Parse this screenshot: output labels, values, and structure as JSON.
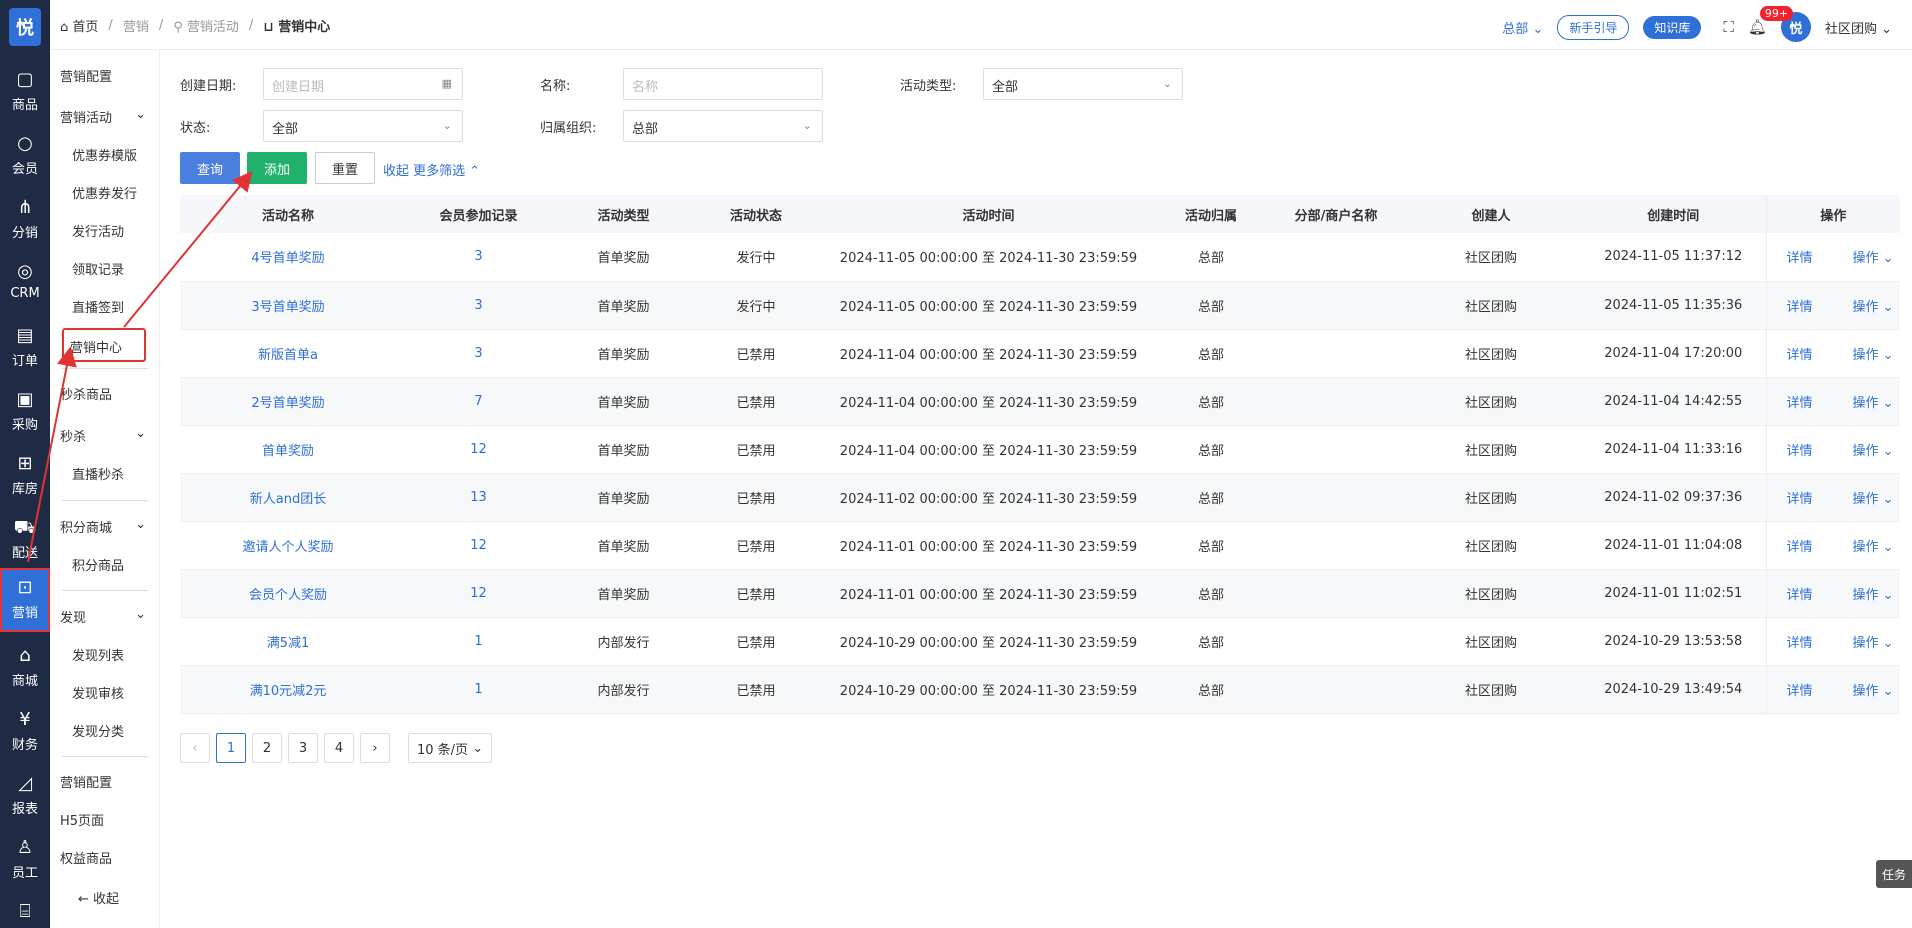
{
  "rail": {
    "logo": "悦",
    "items": [
      {
        "label": "商品",
        "icon": "bag-icon"
      },
      {
        "label": "会员",
        "icon": "person-icon"
      },
      {
        "label": "分销",
        "icon": "network-icon"
      },
      {
        "label": "CRM",
        "icon": "crm-icon"
      },
      {
        "label": "订单",
        "icon": "document-icon"
      },
      {
        "label": "采购",
        "icon": "clipboard-icon"
      },
      {
        "label": "库房",
        "icon": "grid-icon"
      },
      {
        "label": "配送",
        "icon": "truck-icon"
      },
      {
        "label": "营销",
        "icon": "gift-icon"
      },
      {
        "label": "商城",
        "icon": "home-icon"
      },
      {
        "label": "财务",
        "icon": "yen-icon"
      },
      {
        "label": "报表",
        "icon": "chart-icon"
      },
      {
        "label": "员工",
        "icon": "staff-icon"
      },
      {
        "label": "",
        "icon": "store-icon"
      }
    ]
  },
  "submenu": {
    "items": [
      "营销配置",
      "营销活动",
      "优惠券模版",
      "优惠券发行",
      "发行活动",
      "领取记录",
      "直播签到",
      "营销中心",
      "秒杀商品",
      "秒杀",
      "直播秒杀",
      "积分商城",
      "积分商品",
      "发现",
      "发现列表",
      "发现审核",
      "发现分类",
      "营销配置",
      "H5页面",
      "权益商品"
    ],
    "collapse": "收起"
  },
  "header": {
    "breadcrumb": [
      "首页",
      "营销",
      "营销活动",
      "营销中心"
    ],
    "org": "总部",
    "guide": "新手引导",
    "knowledge": "知识库",
    "notify_badge": "99+",
    "avatar": "悦",
    "user": "社区团购"
  },
  "filters": {
    "create_date_label": "创建日期:",
    "create_date_placeholder": "创建日期",
    "name_label": "名称:",
    "name_placeholder": "名称",
    "type_label": "活动类型:",
    "type_value": "全部",
    "status_label": "状态:",
    "status_value": "全部",
    "org_label": "归属组织:",
    "org_value": "总部"
  },
  "actions": {
    "query": "查询",
    "add": "添加",
    "reset": "重置",
    "collapse": "收起 更多筛选"
  },
  "table": {
    "headers": [
      "活动名称",
      "会员参加记录",
      "活动类型",
      "活动状态",
      "活动时间",
      "活动归属",
      "分部/商户名称",
      "创建人",
      "创建时间",
      "操作"
    ],
    "rows": [
      {
        "name": "4号首单奖励",
        "count": "3",
        "type": "首单奖励",
        "status": "发行中",
        "time": "2024-11-05 00:00:00 至 2024-11-30 23:59:59",
        "owner": "总部",
        "branch": "",
        "creator": "社区团购",
        "created": "2024-11-05 11:37:12"
      },
      {
        "name": "3号首单奖励",
        "count": "3",
        "type": "首单奖励",
        "status": "发行中",
        "time": "2024-11-05 00:00:00 至 2024-11-30 23:59:59",
        "owner": "总部",
        "branch": "",
        "creator": "社区团购",
        "created": "2024-11-05 11:35:36"
      },
      {
        "name": "新版首单a",
        "count": "3",
        "type": "首单奖励",
        "status": "已禁用",
        "time": "2024-11-04 00:00:00 至 2024-11-30 23:59:59",
        "owner": "总部",
        "branch": "",
        "creator": "社区团购",
        "created": "2024-11-04 17:20:00"
      },
      {
        "name": "2号首单奖励",
        "count": "7",
        "type": "首单奖励",
        "status": "已禁用",
        "time": "2024-11-04 00:00:00 至 2024-11-30 23:59:59",
        "owner": "总部",
        "branch": "",
        "creator": "社区团购",
        "created": "2024-11-04 14:42:55"
      },
      {
        "name": "首单奖励",
        "count": "12",
        "type": "首单奖励",
        "status": "已禁用",
        "time": "2024-11-04 00:00:00 至 2024-11-30 23:59:59",
        "owner": "总部",
        "branch": "",
        "creator": "社区团购",
        "created": "2024-11-04 11:33:16"
      },
      {
        "name": "新人and团长",
        "count": "13",
        "type": "首单奖励",
        "status": "已禁用",
        "time": "2024-11-02 00:00:00 至 2024-11-30 23:59:59",
        "owner": "总部",
        "branch": "",
        "creator": "社区团购",
        "created": "2024-11-02 09:37:36"
      },
      {
        "name": "邀请人个人奖励",
        "count": "12",
        "type": "首单奖励",
        "status": "已禁用",
        "time": "2024-11-01 00:00:00 至 2024-11-30 23:59:59",
        "owner": "总部",
        "branch": "",
        "creator": "社区团购",
        "created": "2024-11-01 11:04:08"
      },
      {
        "name": "会员个人奖励",
        "count": "12",
        "type": "首单奖励",
        "status": "已禁用",
        "time": "2024-11-01 00:00:00 至 2024-11-30 23:59:59",
        "owner": "总部",
        "branch": "",
        "creator": "社区团购",
        "created": "2024-11-01 11:02:51"
      },
      {
        "name": "满5减1",
        "count": "1",
        "type": "内部发行",
        "status": "已禁用",
        "time": "2024-10-29 00:00:00 至 2024-11-30 23:59:59",
        "owner": "总部",
        "branch": "",
        "creator": "社区团购",
        "created": "2024-10-29 13:53:58"
      },
      {
        "name": "满10元减2元",
        "count": "1",
        "type": "内部发行",
        "status": "已禁用",
        "time": "2024-10-29 00:00:00 至 2024-11-30 23:59:59",
        "owner": "总部",
        "branch": "",
        "creator": "社区团购",
        "created": "2024-10-29 13:49:54"
      }
    ],
    "detail_label": "详情",
    "more_label": "操作"
  },
  "pagination": {
    "pages": [
      "1",
      "2",
      "3",
      "4"
    ],
    "page_size": "10 条/页"
  },
  "task_tab": "任务",
  "colors": {
    "accent": "#2f6fd8",
    "add": "#22b16b",
    "rail": "#1f2a44",
    "annotation": "#e03333"
  }
}
